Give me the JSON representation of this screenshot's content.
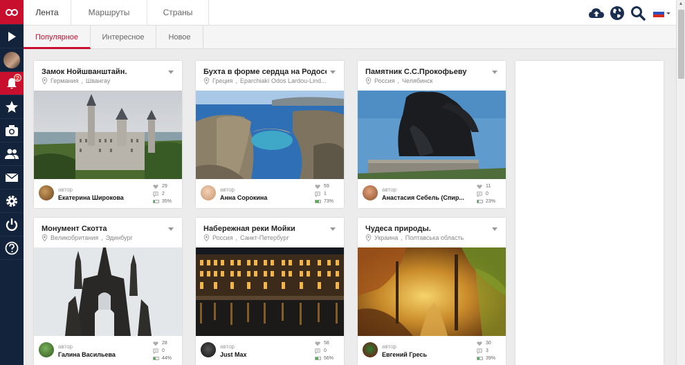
{
  "top_tabs": [
    {
      "label": "Лента",
      "active": true
    },
    {
      "label": "Маршруты",
      "active": false
    },
    {
      "label": "Страны",
      "active": false
    }
  ],
  "sub_tabs": [
    {
      "label": "Популярное",
      "active": true
    },
    {
      "label": "Интересное",
      "active": false
    },
    {
      "label": "Новое",
      "active": false
    }
  ],
  "sidebar": {
    "notification_count": "2",
    "items": [
      "play-icon",
      "avatar",
      "bell-icon",
      "star-icon",
      "camera-icon",
      "users-icon",
      "mail-icon",
      "gear-icon",
      "power-icon",
      "help-icon"
    ]
  },
  "top_icons": [
    "cloud-upload-icon",
    "globe-icon",
    "search-icon",
    "flag-ru-icon"
  ],
  "colors": {
    "accent": "#c8102e",
    "sidebar": "#14233c",
    "progress": "#4caf50"
  },
  "author_label": "автор",
  "cards": [
    {
      "title": "Замок Нойшванштайн.",
      "country": "Германия",
      "place": "Швангау",
      "author": "Екатерина Широкова",
      "likes": "29",
      "comments": "2",
      "progress": "35%"
    },
    {
      "title": "Бухта в форме сердца на Родосе",
      "country": "Греция",
      "place": "Eparchiakí Odos Lardou-Lind...",
      "author": "Анна Сорокина",
      "likes": "59",
      "comments": "1",
      "progress": "73%"
    },
    {
      "title": "Памятник С.С.Прокофьеву",
      "country": "Россия",
      "place": "Челябинск",
      "author": "Анастасия Себель (Спир...",
      "likes": "11",
      "comments": "0",
      "progress": "23%"
    },
    {
      "title": "Монумент Скотта",
      "country": "Великобритания",
      "place": "Эдинбург",
      "author": "Галина Васильева",
      "likes": "28",
      "comments": "0",
      "progress": "44%"
    },
    {
      "title": "Набережная реки Мойки",
      "country": "Россия",
      "place": "Санкт-Петербург",
      "author": "Just Max",
      "likes": "58",
      "comments": "0",
      "progress": "56%"
    },
    {
      "title": "Чудеса природы.",
      "country": "Украина",
      "place": "Полтавська область",
      "author": "Евгений Гресь",
      "likes": "30",
      "comments": "3",
      "progress": "39%"
    }
  ]
}
